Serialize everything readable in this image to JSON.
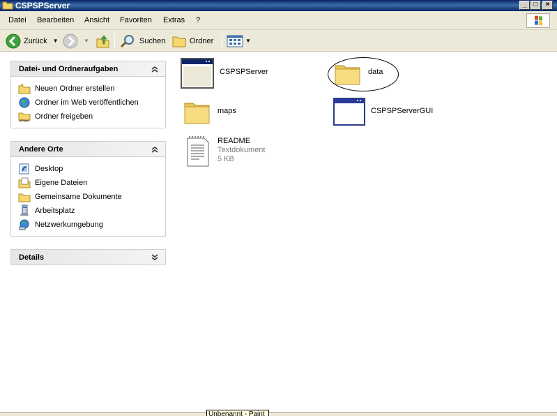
{
  "window": {
    "title": "CSPSPServer"
  },
  "menu": [
    "Datei",
    "Bearbeiten",
    "Ansicht",
    "Favoriten",
    "Extras",
    "?"
  ],
  "toolbar": {
    "back": "Zurück",
    "search": "Suchen",
    "folders": "Ordner"
  },
  "panels": {
    "tasks": {
      "title": "Datei- und Ordneraufgaben",
      "items": [
        "Neuen Ordner erstellen",
        "Ordner im Web veröffentlichen",
        "Ordner freigeben"
      ]
    },
    "places": {
      "title": "Andere Orte",
      "items": [
        "Desktop",
        "Eigene Dateien",
        "Gemeinsame Dokumente",
        "Arbeitsplatz",
        "Netzwerkumgebung"
      ]
    },
    "details": {
      "title": "Details"
    }
  },
  "files": [
    {
      "name": "CSPSPServer",
      "icon": "application-window-icon"
    },
    {
      "name": "data",
      "icon": "folder-icon"
    },
    {
      "name": "maps",
      "icon": "folder-icon"
    },
    {
      "name": "CSPSPServerGUI",
      "icon": "application-window-icon"
    },
    {
      "name": "README",
      "type": "Textdokument",
      "size": "5 KB",
      "icon": "text-document-icon"
    }
  ],
  "tooltip": "Unbenannt - Paint",
  "colors": {
    "titlebar": "#0a246a",
    "menubar": "#ece9d8",
    "folder": "#f5d76e"
  }
}
